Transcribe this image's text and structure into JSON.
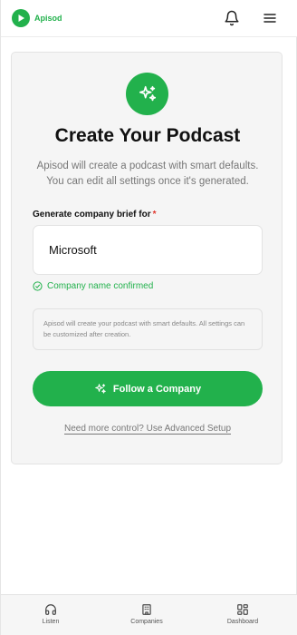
{
  "header": {
    "logo_text": "Apisod",
    "logo_icon": "play-icon",
    "notification_icon": "bell-icon",
    "menu_icon": "hamburger-icon"
  },
  "card": {
    "hero_icon": "sparkles-icon",
    "title": "Create Your Podcast",
    "subtitle": "Apisod will create a podcast with smart defaults. You can edit all settings once it's generated.",
    "field_label": "Generate company brief for",
    "required_marker": "*",
    "company_input_value": "Microsoft",
    "confirm_text": "Company name confirmed",
    "info_text": "Apisod will create your podcast with smart defaults. All settings can be customized after creation.",
    "follow_button_label": "Follow a Company",
    "advanced_link": "Need more control? Use Advanced Setup"
  },
  "bottom_nav": {
    "items": [
      {
        "label": "Listen",
        "icon": "headphones-icon"
      },
      {
        "label": "Companies",
        "icon": "building-icon"
      },
      {
        "label": "Dashboard",
        "icon": "dashboard-grid-icon"
      }
    ]
  },
  "colors": {
    "accent": "#22b14c",
    "required": "#e0362c"
  }
}
